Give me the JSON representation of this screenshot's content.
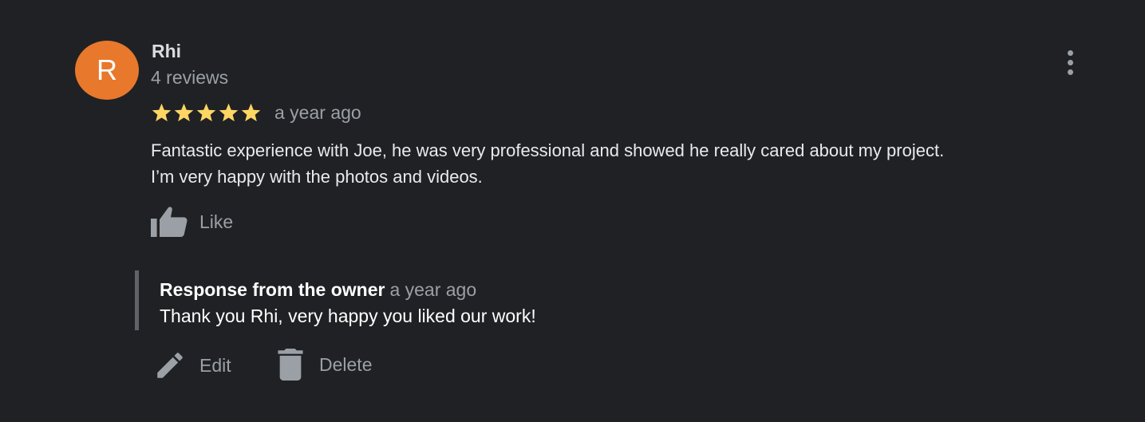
{
  "review": {
    "avatar_initial": "R",
    "reviewer_name": "Rhi",
    "review_count": "4 reviews",
    "rating": 5,
    "rating_max": 5,
    "date": "a year ago",
    "text": "Fantastic experience with Joe, he was very professional and showed he really cared about my project.\nI’m very happy with the photos and videos.",
    "like_label": "Like",
    "more_menu_icon": "more-vert-icon"
  },
  "owner_response": {
    "title": "Response from the owner",
    "date": "a year ago",
    "text": "Thank you Rhi, very happy you liked our work!"
  },
  "actions": {
    "edit_label": "Edit",
    "delete_label": "Delete",
    "edit_icon": "pencil-icon",
    "delete_icon": "trash-icon"
  },
  "colors": {
    "background": "#202124",
    "avatar": "#e8782c",
    "star": "#fdd663",
    "secondary_text": "#9aa0a6",
    "response_bar": "#5f6368"
  }
}
